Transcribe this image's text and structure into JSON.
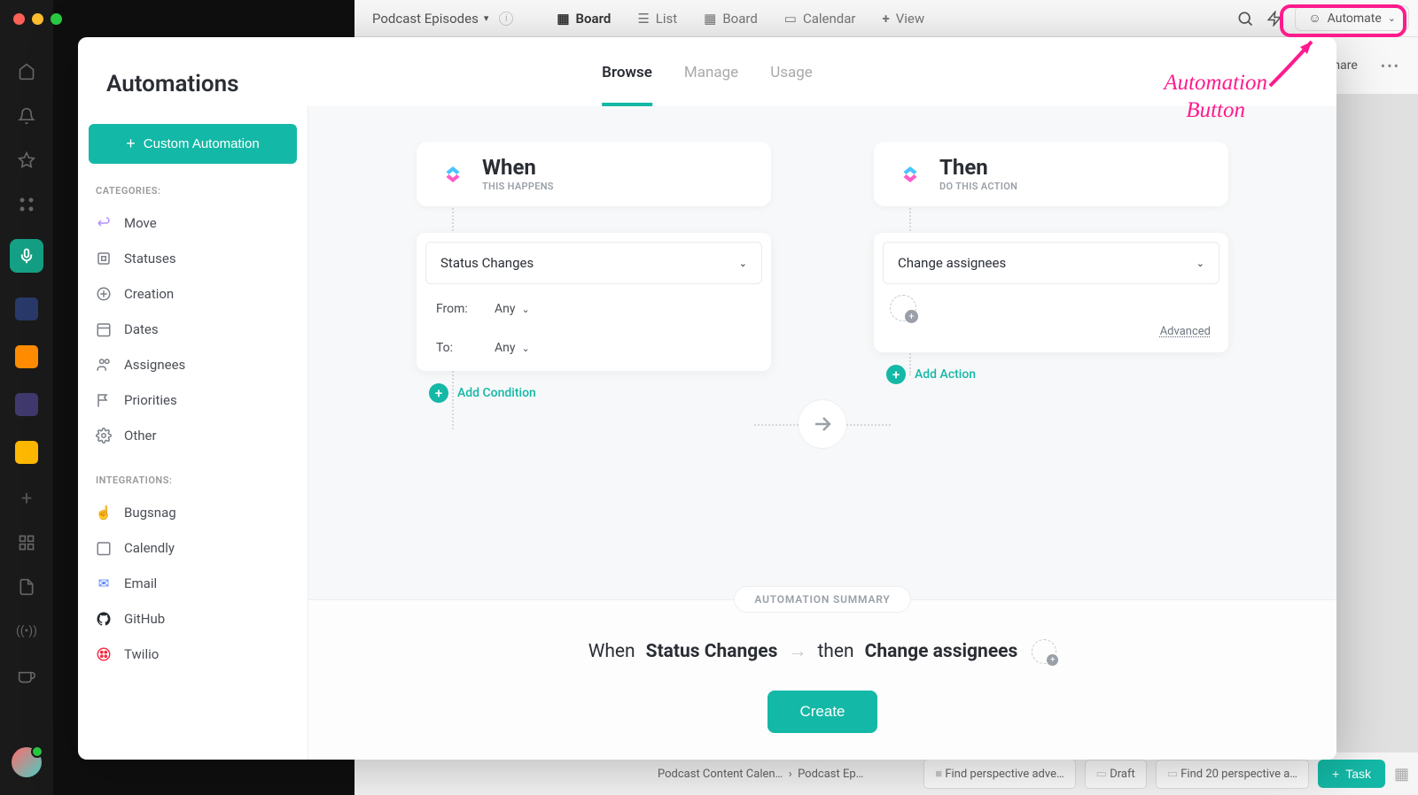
{
  "window": {
    "space_name": "Podcast Episodes"
  },
  "topbar": {
    "views": [
      {
        "label": "Board",
        "bold": true
      },
      {
        "label": "List"
      },
      {
        "label": "Board"
      },
      {
        "label": "Calendar"
      },
      {
        "label": "View",
        "plus": true
      }
    ],
    "automate_label": "Automate",
    "share_label": "Share"
  },
  "modal": {
    "title": "Automations",
    "tabs": {
      "browse": "Browse",
      "manage": "Manage",
      "usage": "Usage"
    },
    "custom_btn": "Custom Automation",
    "section_categories": "CATEGORIES:",
    "section_integrations": "INTEGRATIONS:",
    "categories": [
      {
        "key": "move",
        "label": "Move"
      },
      {
        "key": "statuses",
        "label": "Statuses"
      },
      {
        "key": "creation",
        "label": "Creation"
      },
      {
        "key": "dates",
        "label": "Dates"
      },
      {
        "key": "assignees",
        "label": "Assignees"
      },
      {
        "key": "priorities",
        "label": "Priorities"
      },
      {
        "key": "other",
        "label": "Other"
      }
    ],
    "integrations": [
      {
        "key": "bugsnag",
        "label": "Bugsnag"
      },
      {
        "key": "calendly",
        "label": "Calendly"
      },
      {
        "key": "email",
        "label": "Email"
      },
      {
        "key": "github",
        "label": "GitHub"
      },
      {
        "key": "twilio",
        "label": "Twilio"
      }
    ]
  },
  "builder": {
    "when": {
      "title": "When",
      "subtitle": "THIS HAPPENS",
      "trigger_label": "Status Changes",
      "from_label": "From:",
      "from_value": "Any",
      "to_label": "To:",
      "to_value": "Any",
      "add_condition": "Add Condition"
    },
    "then": {
      "title": "Then",
      "subtitle": "DO THIS ACTION",
      "action_label": "Change assignees",
      "advanced": "Advanced",
      "add_action": "Add Action"
    }
  },
  "summary": {
    "badge": "AUTOMATION SUMMARY",
    "when_prefix": "When",
    "when_value": "Status Changes",
    "then_prefix": "then",
    "then_value": "Change assignees",
    "create": "Create"
  },
  "annotation": {
    "line1": "Automation",
    "line2": "Button"
  },
  "bottom": {
    "crumb1": "Podcast Content Calen…",
    "crumb2": "Podcast Ep…",
    "card1": "Find perspective adve…",
    "card2": "Draft",
    "card3": "Find 20 perspective a…",
    "task_btn": "Task"
  }
}
